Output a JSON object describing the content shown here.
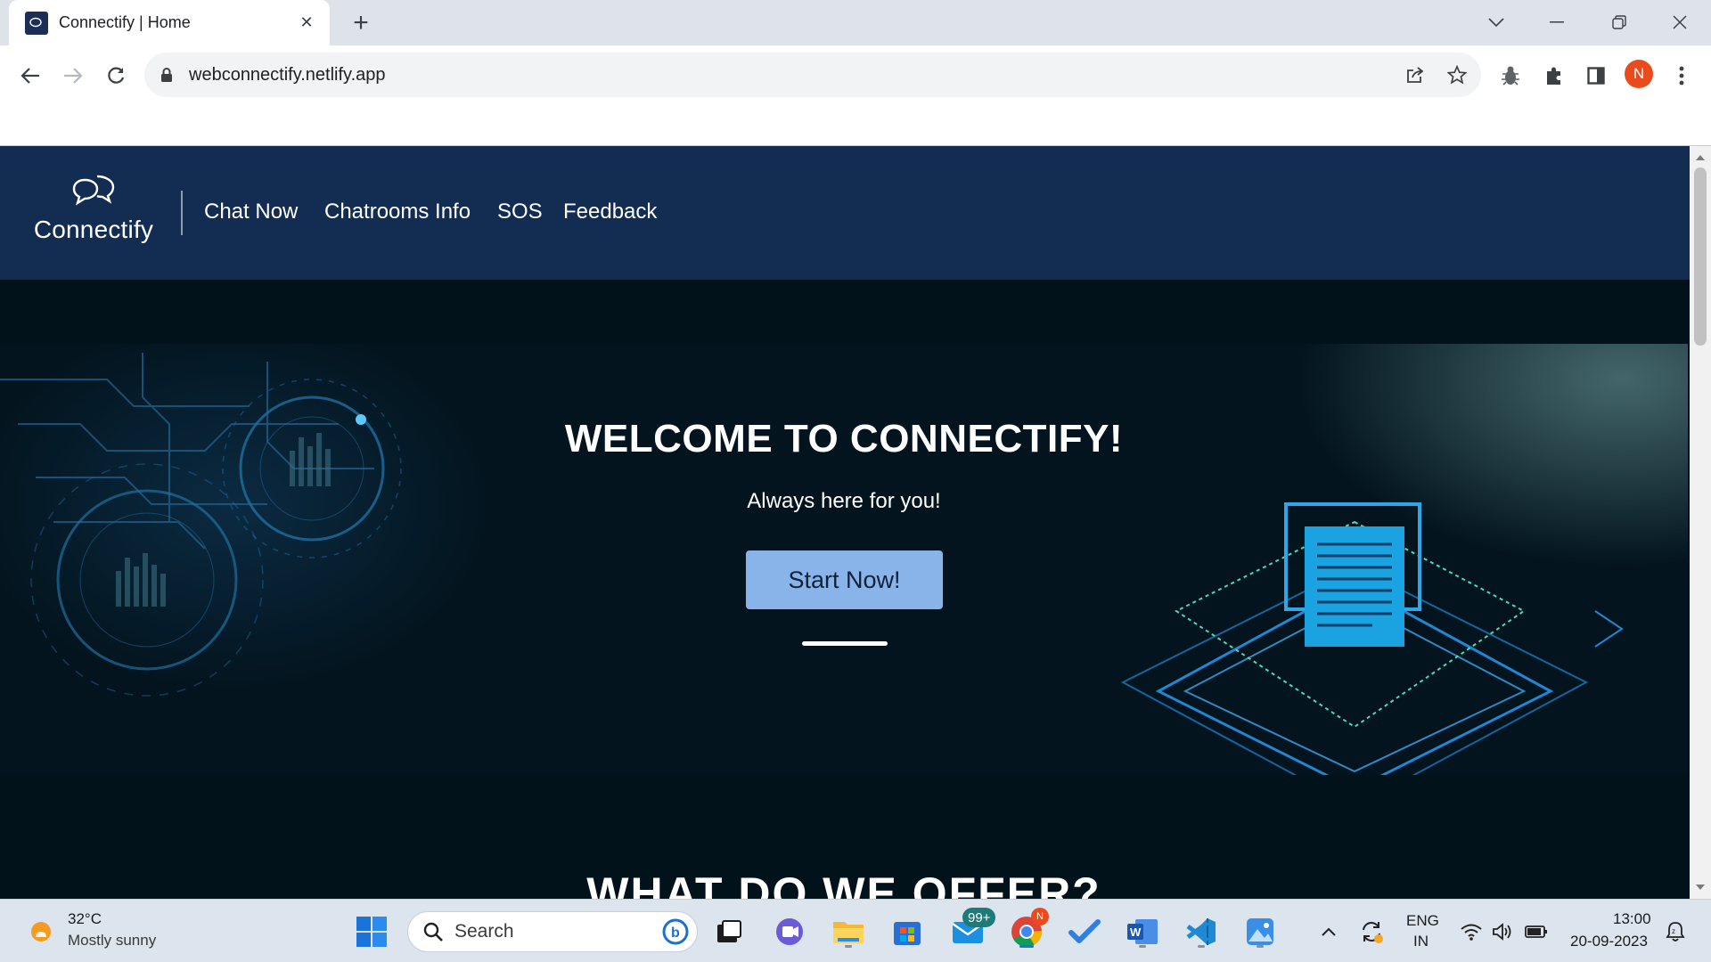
{
  "browser": {
    "tab_title": "Connectify | Home",
    "favicon_text": "Connectify",
    "new_tab_label": "+",
    "url": "webconnectify.netlify.app",
    "profile_initial": "N"
  },
  "site": {
    "logo_text": "Connectify",
    "nav": [
      "Chat Now",
      "Chatrooms Info",
      "SOS",
      "Feedback"
    ],
    "hero": {
      "title": "WELCOME TO CONNECTIFY!",
      "subtitle": "Always here for you!",
      "button": "Start Now!"
    },
    "section_heading": "WHAT DO WE OFFER?"
  },
  "taskbar": {
    "weather_temp": "32°C",
    "weather_desc": "Mostly sunny",
    "search_label": "Search",
    "mail_badge": "99+",
    "chrome_badge": "N",
    "lang_line1": "ENG",
    "lang_line2": "IN",
    "time": "13:00",
    "date": "20-09-2023"
  },
  "colors": {
    "nav_bg": "#132c52",
    "page_bg": "#02121b",
    "button_bg": "#88b4ea",
    "profile": "#ea4b1c"
  }
}
